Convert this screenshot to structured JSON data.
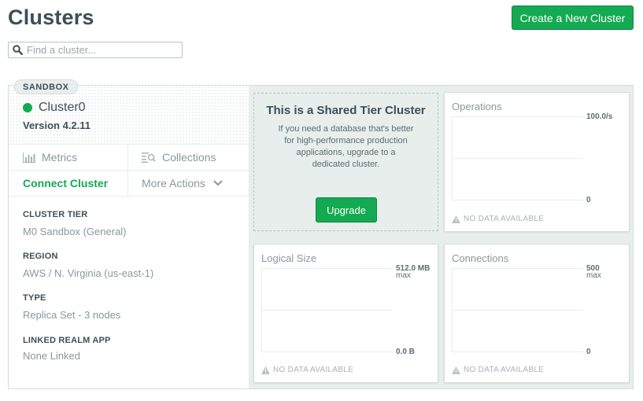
{
  "header": {
    "title": "Clusters",
    "create_button": "Create a New Cluster",
    "search_placeholder": "Find a cluster..."
  },
  "cluster": {
    "badge": "SANDBOX",
    "name": "Cluster0",
    "version": "Version 4.2.11",
    "status_color": "#13aa52",
    "nav": {
      "metrics": "Metrics",
      "collections": "Collections",
      "connect": "Connect Cluster",
      "more_actions": "More Actions"
    },
    "info": [
      {
        "label": "CLUSTER TIER",
        "value": "M0 Sandbox (General)"
      },
      {
        "label": "REGION",
        "value": "AWS / N. Virginia (us-east-1)"
      },
      {
        "label": "TYPE",
        "value": "Replica Set - 3 nodes"
      },
      {
        "label": "LINKED REALM APP",
        "value": "None Linked"
      }
    ]
  },
  "shared_tier": {
    "title": "This is a Shared Tier Cluster",
    "description": "If you need a database that's better for high-performance production applications, upgrade to a dedicated cluster.",
    "upgrade_button": "Upgrade"
  },
  "metrics": {
    "operations": {
      "title": "Operations",
      "max": "100.0/s",
      "max_unit": "",
      "min": "0",
      "no_data": "NO DATA AVAILABLE"
    },
    "logical_size": {
      "title": "Logical Size",
      "max": "512.0 MB",
      "max_unit": "max",
      "min": "0.0 B",
      "no_data": "NO DATA AVAILABLE"
    },
    "connections": {
      "title": "Connections",
      "max": "500",
      "max_unit": "max",
      "min": "0",
      "no_data": "NO DATA AVAILABLE"
    }
  },
  "colors": {
    "accent": "#13aa52",
    "text": "#3d4f58",
    "muted": "#89989b",
    "panel_bg": "#e7eeec"
  }
}
